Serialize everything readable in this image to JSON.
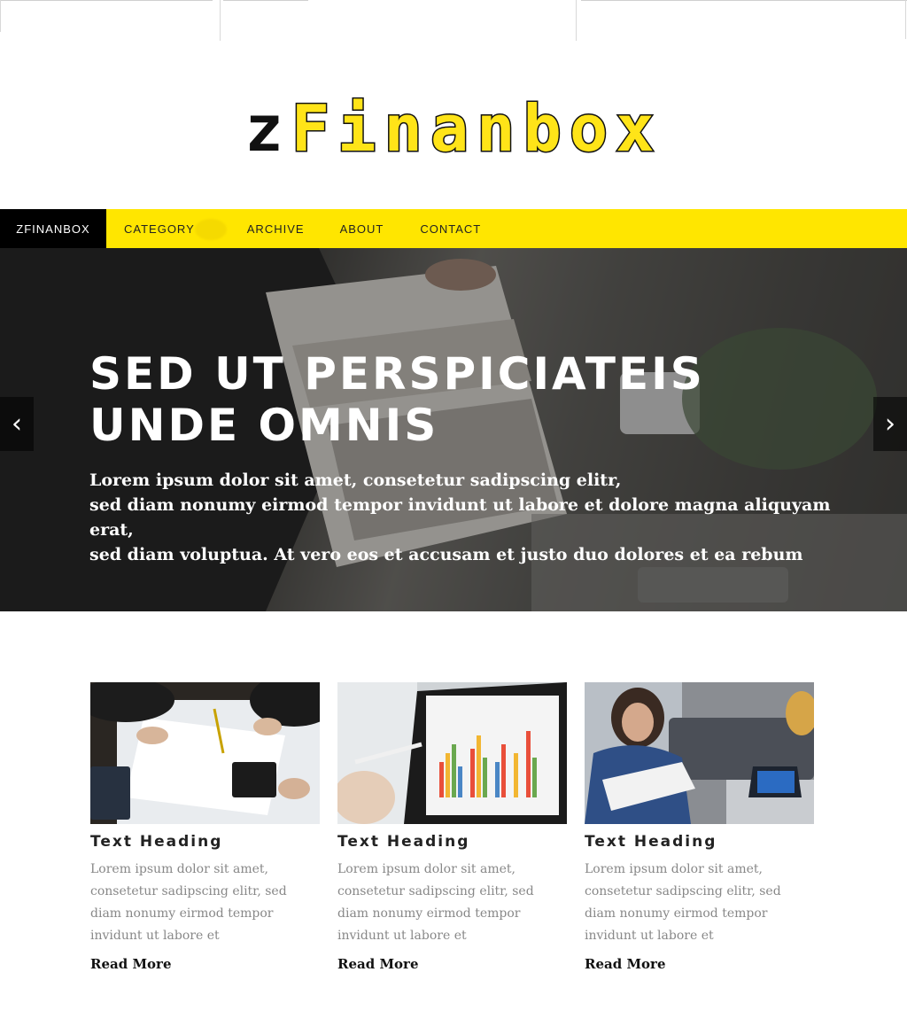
{
  "brand": {
    "logo_first": "z",
    "logo_rest": "Finanbox"
  },
  "nav": {
    "home": "ZFINANBOX",
    "items": [
      "CATEGORY",
      "ARCHIVE",
      "ABOUT",
      "CONTACT"
    ]
  },
  "hero": {
    "title": "SED UT PERSPICIATEIS UNDE OMNIS",
    "text_line1": "Lorem ipsum dolor sit amet, consetetur sadipscing elitr,",
    "text_line2": "sed diam nonumy eirmod tempor invidunt ut labore et dolore magna aliquyam erat,",
    "text_line3": "sed diam voluptua. At vero eos et accusam et justo duo dolores et ea rebum",
    "prev_icon": "‹",
    "next_icon": "›"
  },
  "cards": [
    {
      "image_icon": "meeting-photo",
      "heading": "Text Heading",
      "text": "Lorem ipsum dolor sit amet, consetetur sadipscing elitr, sed diam nonumy eirmod tempor invidunt ut labore et",
      "link": "Read More"
    },
    {
      "image_icon": "tablet-chart-photo",
      "heading": "Text Heading",
      "text": "Lorem ipsum dolor sit amet, consetetur sadipscing elitr, sed diam nonumy eirmod tempor invidunt ut labore et",
      "link": "Read More"
    },
    {
      "image_icon": "woman-laptop-photo",
      "heading": "Text Heading",
      "text": "Lorem ipsum dolor sit amet, consetetur sadipscing elitr, sed diam nonumy eirmod tempor invidunt ut labore et",
      "link": "Read More"
    }
  ],
  "colors": {
    "accent": "#ffe600",
    "nav_home_bg": "#000000",
    "body_text": "#888888"
  }
}
